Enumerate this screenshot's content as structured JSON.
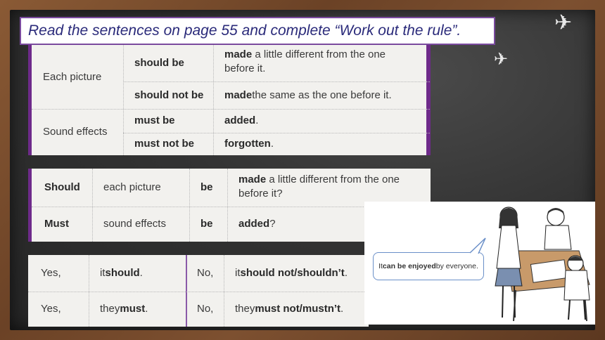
{
  "title": "Read the sentences on page 55 and complete “Work out the rule”.",
  "table1": {
    "subject1": "Each picture",
    "row1_verb": "should be",
    "row1_rest_bold": "made",
    "row1_rest_line1": " a little different from the one",
    "row1_rest_line2": "before it.",
    "row2_verb": "should not be",
    "row2_rest_bold": "made",
    "row2_rest": " the same as the one before it.",
    "subject2": "Sound effects",
    "row3_verb": "must be",
    "row3_rest_bold": "added",
    "row3_rest": ".",
    "row4_verb": "must not be",
    "row4_rest_bold": "forgotten",
    "row4_rest": "."
  },
  "table2": {
    "r1_modal": "Should",
    "r1_subject": "each picture",
    "r1_be": "be",
    "r1_bold": "made",
    "r1_line1": " a little different from the one",
    "r1_line2": "before it?",
    "r2_modal": "Must",
    "r2_subject": "sound effects",
    "r2_be": "be",
    "r2_bold": "added",
    "r2_rest": "?"
  },
  "table3": {
    "r1_yes": "Yes,",
    "r1_pre": "it ",
    "r1_bold": "should",
    "r1_post": ".",
    "r1_no": "No,",
    "r1_npre": "it ",
    "r1_nbold": "should not/shouldn’t",
    "r1_npost": ".",
    "r2_yes": "Yes,",
    "r2_pre": "they ",
    "r2_bold": "must",
    "r2_post": ".",
    "r2_no": "No,",
    "r2_npre": "they ",
    "r2_nbold": "must not/mustn’t",
    "r2_npost": "."
  },
  "illustration": {
    "bubble_pre": "It ",
    "bubble_bold": "can be enjoyed",
    "bubble_post": " by everyone."
  },
  "colors": {
    "title_text": "#2a2a7a",
    "accent_purple": "#6e2a8a",
    "frame_wood": "#6b4226",
    "board": "#333333"
  }
}
